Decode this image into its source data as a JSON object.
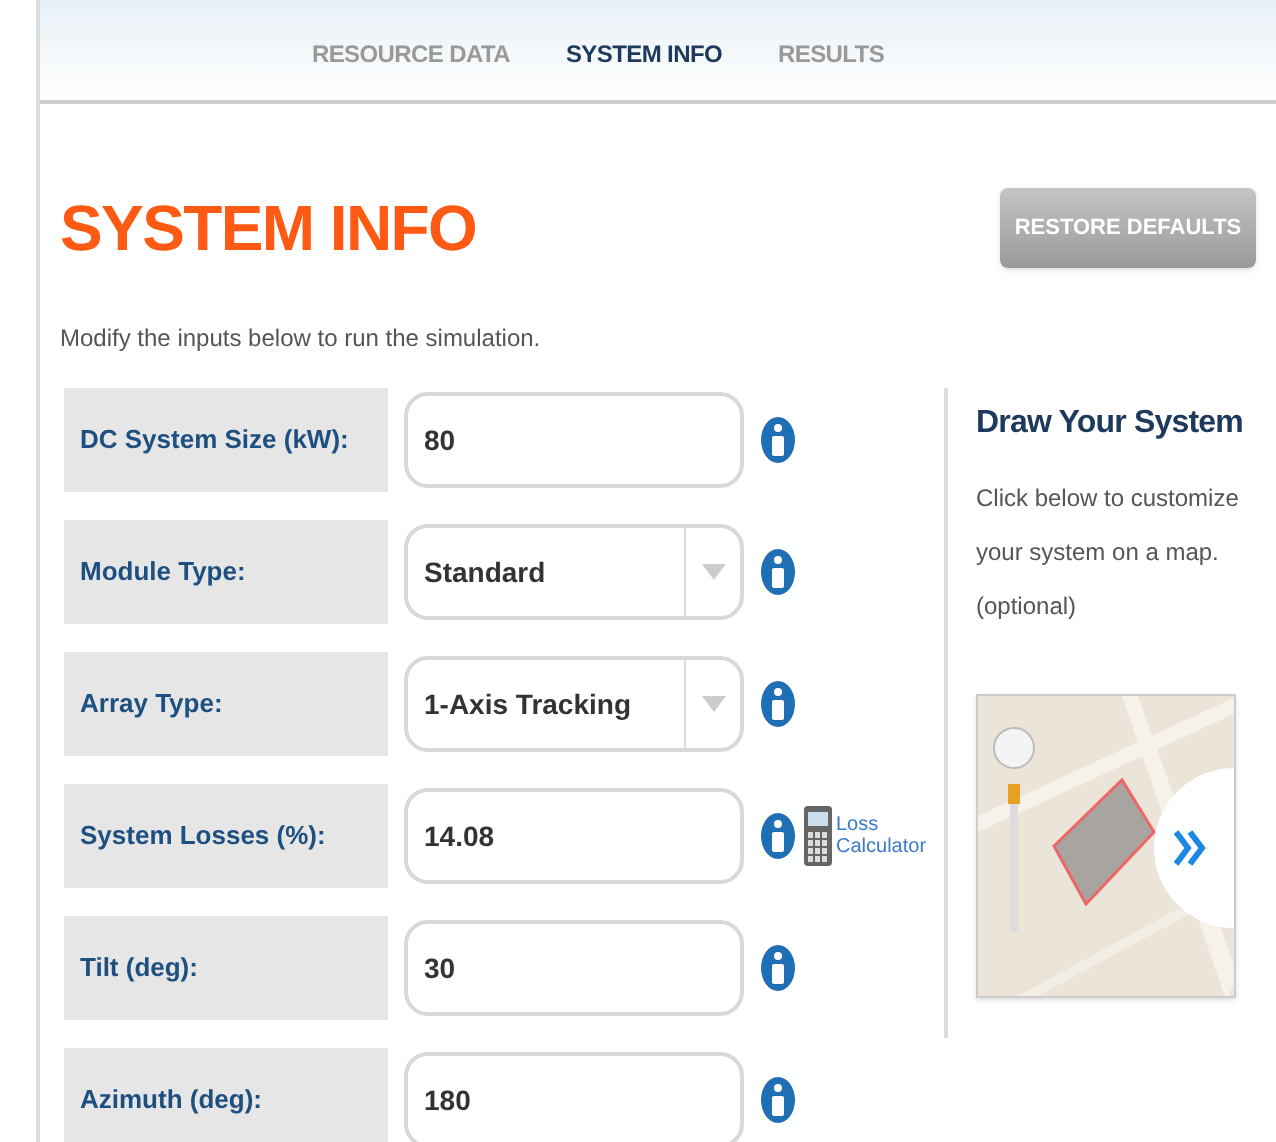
{
  "tabs": [
    {
      "label": "RESOURCE DATA",
      "selected": false
    },
    {
      "label": "SYSTEM INFO",
      "selected": true
    },
    {
      "label": "RESULTS",
      "selected": false
    }
  ],
  "title": "SYSTEM INFO",
  "restore_button": "RESTORE DEFAULTS",
  "intro": "Modify the inputs below to run the simulation.",
  "fields": [
    {
      "label": "DC System Size (kW):",
      "kind": "text",
      "value": "80"
    },
    {
      "label": "Module Type:",
      "kind": "select",
      "value": "Standard"
    },
    {
      "label": "Array Type:",
      "kind": "select",
      "value": "1-Axis Tracking"
    },
    {
      "label": "System Losses (%):",
      "kind": "text",
      "value": "14.08",
      "link": "Loss Calculator"
    },
    {
      "label": "Tilt (deg):",
      "kind": "text",
      "value": "30"
    },
    {
      "label": "Azimuth (deg):",
      "kind": "text",
      "value": "180"
    }
  ],
  "side": {
    "heading": "Draw Your System",
    "text": "Click below to customize your system on a map. (optional)"
  }
}
